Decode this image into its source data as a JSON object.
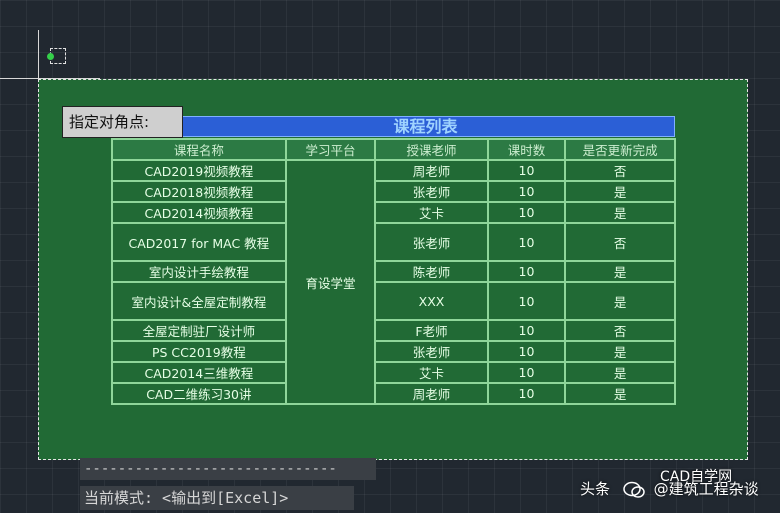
{
  "tooltip": "指定对角点:",
  "table": {
    "title": "课程列表",
    "headers": [
      "课程名称",
      "学习平台",
      "授课老师",
      "课时数",
      "是否更新完成"
    ],
    "platform": "育设学堂",
    "rows": [
      {
        "name": "CAD2019视频教程",
        "teacher": "周老师",
        "hours": "10",
        "done": "否"
      },
      {
        "name": "CAD2018视频教程",
        "teacher": "张老师",
        "hours": "10",
        "done": "是"
      },
      {
        "name": "CAD2014视频教程",
        "teacher": "艾卡",
        "hours": "10",
        "done": "是"
      },
      {
        "name": "CAD2017 for MAC 教程",
        "teacher": "张老师",
        "hours": "10",
        "done": "否"
      },
      {
        "name": "室内设计手绘教程",
        "teacher": "陈老师",
        "hours": "10",
        "done": "是"
      },
      {
        "name": "室内设计&全屋定制教程",
        "teacher": "XXX",
        "hours": "10",
        "done": "是"
      },
      {
        "name": "全屋定制驻厂设计师",
        "teacher": "F老师",
        "hours": "10",
        "done": "否"
      },
      {
        "name": "PS CC2019教程",
        "teacher": "张老师",
        "hours": "10",
        "done": "是"
      },
      {
        "name": "CAD2014三维教程",
        "teacher": "艾卡",
        "hours": "10",
        "done": "是"
      },
      {
        "name": "CAD二维练习30讲",
        "teacher": "周老师",
        "hours": "10",
        "done": "是"
      }
    ]
  },
  "command": {
    "dashes": "------------------------------",
    "mode": "当前模式: <输出到[Excel]>"
  },
  "brand": {
    "left": "头条",
    "handle": "@建筑工程杂谈",
    "sub": "CAD自学网"
  }
}
